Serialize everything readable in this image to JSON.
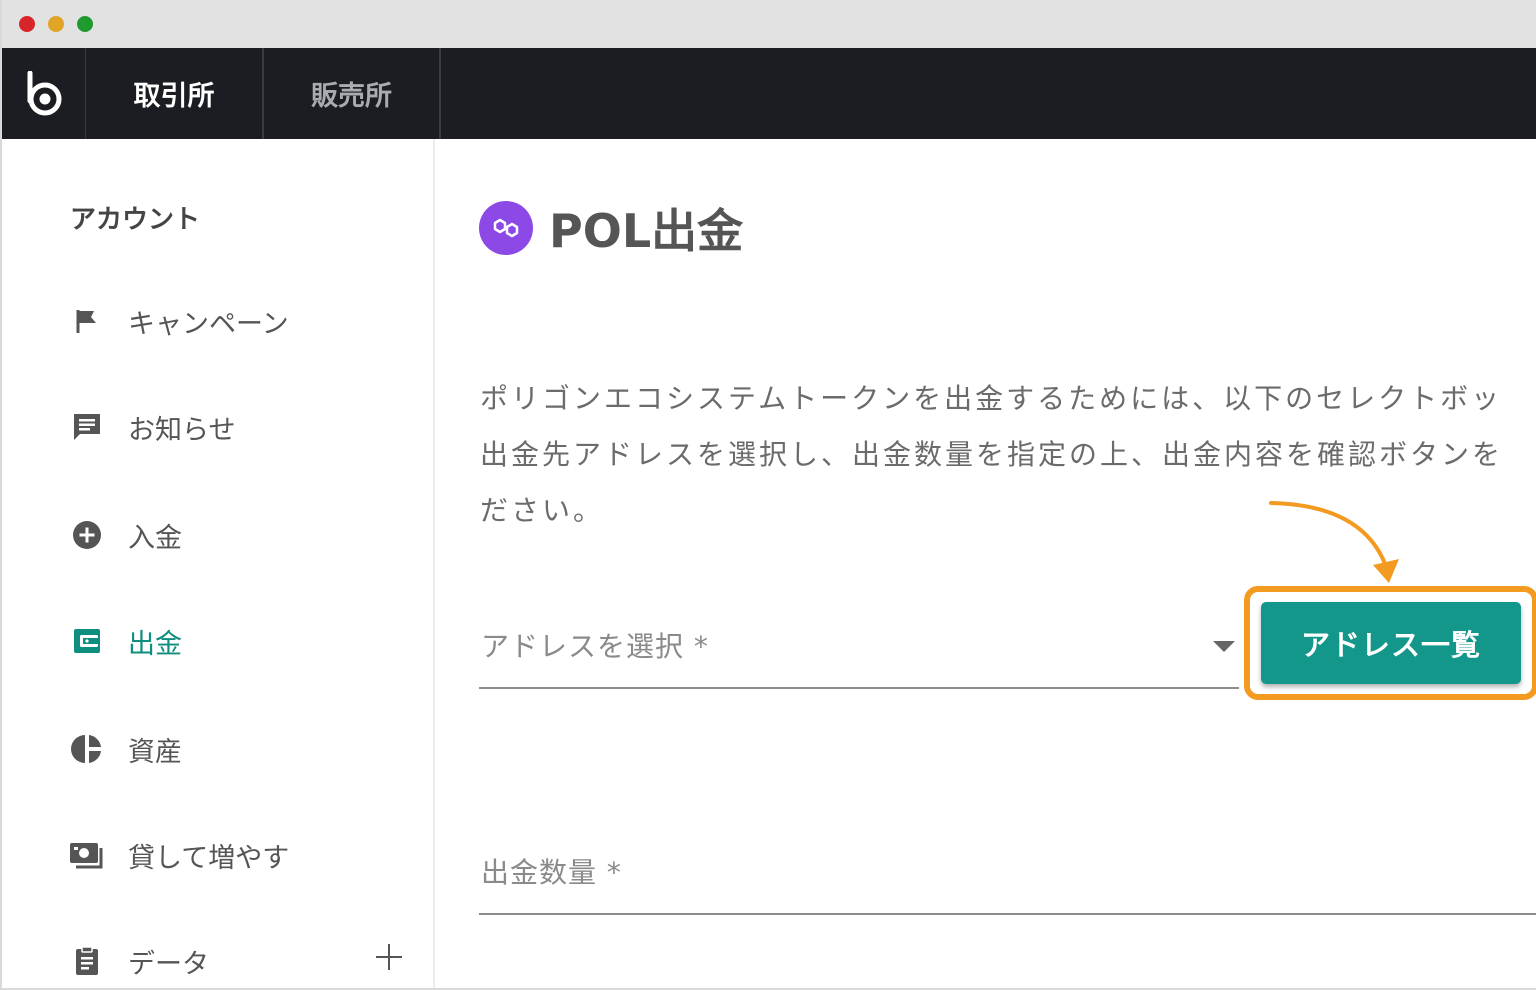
{
  "window": {
    "controls": [
      "close",
      "minimize",
      "maximize"
    ]
  },
  "topnav": {
    "logo_icon": "bitbank-logo-icon",
    "tabs": [
      {
        "label": "取引所",
        "active": true
      },
      {
        "label": "販売所",
        "active": false
      }
    ]
  },
  "sidebar": {
    "title": "アカウント",
    "items": [
      {
        "label": "キャンペーン",
        "icon": "flag-icon",
        "active": false
      },
      {
        "label": "お知らせ",
        "icon": "message-icon",
        "active": false
      },
      {
        "label": "入金",
        "icon": "plus-circle-icon",
        "active": false
      },
      {
        "label": "出金",
        "icon": "wallet-icon",
        "active": true
      },
      {
        "label": "資産",
        "icon": "pie-chart-icon",
        "active": false
      },
      {
        "label": "貸して増やす",
        "icon": "cash-icon",
        "active": false
      },
      {
        "label": "データ",
        "icon": "clipboard-icon",
        "active": false
      }
    ],
    "expand_icon": "plus-icon"
  },
  "main": {
    "title": "POL出金",
    "title_icon": "polygon-icon",
    "description_lines": [
      "ポリゴンエコシステムトークンを出金するためには、以下のセレクトボッ",
      "出金先アドレスを選択し、出金数量を指定の上、出金内容を確認ボタンを",
      "ださい。"
    ],
    "address_select": {
      "label": "アドレスを選択 *"
    },
    "address_list_button": "アドレス一覧",
    "amount_field": {
      "label": "出金数量 *"
    }
  },
  "colors": {
    "accent": "#12978a",
    "highlight": "#f39a21",
    "nav_bg": "#1b1d22",
    "polygon": "#8c49e6"
  }
}
